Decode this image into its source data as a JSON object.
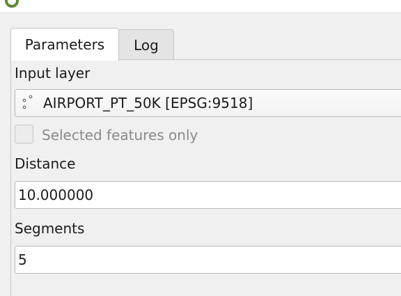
{
  "tabs": [
    {
      "label": "Parameters",
      "active": true
    },
    {
      "label": "Log",
      "active": false
    }
  ],
  "params": {
    "input_layer": {
      "label": "Input layer",
      "value": "AIRPORT_PT_50K [EPSG:9518]",
      "icon": "point-layer-icon"
    },
    "selected_only": {
      "label": "Selected features only",
      "checked": false,
      "enabled": false
    },
    "distance": {
      "label": "Distance",
      "value": "10.000000"
    },
    "segments": {
      "label": "Segments",
      "value": "5"
    }
  },
  "colors": {
    "background": "#f0f0f0",
    "field_border": "#b9b9b9",
    "disabled_text": "#8a8a8a",
    "logo_green": "#5b8a32"
  }
}
